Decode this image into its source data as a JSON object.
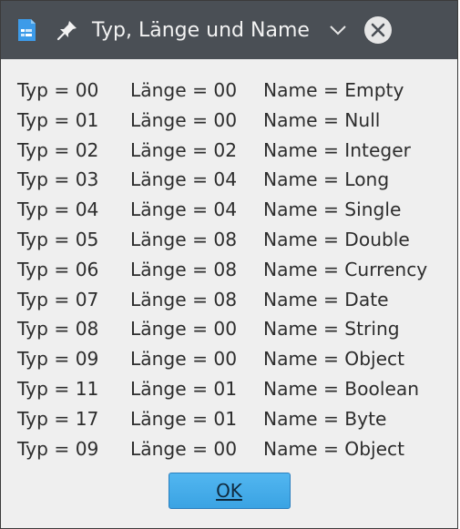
{
  "window": {
    "title": "Typ, Länge und Name"
  },
  "rows": [
    {
      "typ": "Typ = 00",
      "laenge": "Länge = 00",
      "name": "Name = Empty"
    },
    {
      "typ": "Typ = 01",
      "laenge": "Länge = 00",
      "name": "Name = Null"
    },
    {
      "typ": "Typ = 02",
      "laenge": "Länge = 02",
      "name": "Name = Integer"
    },
    {
      "typ": "Typ = 03",
      "laenge": "Länge = 04",
      "name": "Name = Long"
    },
    {
      "typ": "Typ = 04",
      "laenge": "Länge = 04",
      "name": "Name = Single"
    },
    {
      "typ": "Typ = 05",
      "laenge": "Länge = 08",
      "name": "Name = Double"
    },
    {
      "typ": "Typ = 06",
      "laenge": "Länge = 08",
      "name": "Name = Currency"
    },
    {
      "typ": "Typ = 07",
      "laenge": "Länge = 08",
      "name": "Name = Date"
    },
    {
      "typ": "Typ = 08",
      "laenge": "Länge = 00",
      "name": "Name = String"
    },
    {
      "typ": "Typ = 09",
      "laenge": "Länge = 00",
      "name": "Name = Object"
    },
    {
      "typ": "Typ = 11",
      "laenge": "Länge = 01",
      "name": "Name = Boolean"
    },
    {
      "typ": "Typ = 17",
      "laenge": "Länge = 01",
      "name": "Name = Byte"
    },
    {
      "typ": "Typ = 09",
      "laenge": "Länge = 00",
      "name": "Name = Object"
    }
  ],
  "buttons": {
    "ok_label": "OK"
  },
  "icons": {
    "app": "document-icon",
    "pin": "pin-icon",
    "minimize": "chevron-down-icon",
    "close": "close-icon"
  }
}
